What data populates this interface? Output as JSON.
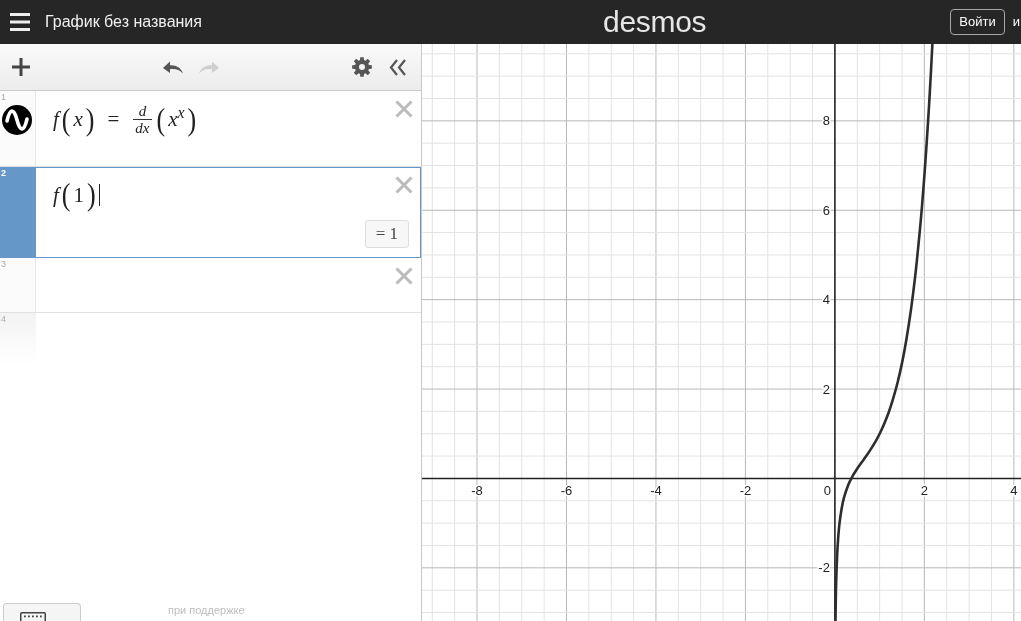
{
  "header": {
    "title": "График без названия",
    "logo": "desmos",
    "login_button": "Войти",
    "trailing_text": "и"
  },
  "toolbar": {
    "undo": {
      "disabled": false
    },
    "redo": {
      "disabled": true
    }
  },
  "expressions": [
    {
      "number": "1",
      "kind": "graph",
      "selected": false,
      "math": [
        {
          "kind": "var",
          "text": "f"
        },
        {
          "kind": "paren",
          "open": "(",
          "close": ")",
          "body": [
            {
              "kind": "var",
              "text": "x"
            }
          ]
        },
        {
          "kind": "op",
          "text": "="
        },
        {
          "kind": "frac",
          "num": "d",
          "den": "dx"
        },
        {
          "kind": "paren",
          "open": "(",
          "close": ")",
          "body": [
            {
              "kind": "var",
              "text": "x$^{x}$"
            }
          ]
        }
      ]
    },
    {
      "number": "2",
      "kind": "value",
      "selected": true,
      "math": [
        {
          "kind": "var",
          "text": "f"
        },
        {
          "kind": "paren",
          "open": "(",
          "close": ")",
          "body": [
            {
              "kind": "num",
              "text": "1"
            }
          ]
        }
      ],
      "result": "= 1"
    },
    {
      "number": "3",
      "kind": "empty",
      "selected": false
    },
    {
      "number": "4",
      "kind": "ghost",
      "selected": false
    }
  ],
  "footer": {
    "powered_by": "при поддержке"
  },
  "graph": {
    "origin_label": "0",
    "chart_data": {
      "type": "line",
      "grid": true,
      "xlim": [
        -9.23,
        4.16
      ],
      "ylim": [
        -3.19,
        9.72
      ],
      "xticks": [
        -8,
        -6,
        -4,
        -2,
        2,
        4
      ],
      "yticks": [
        -2,
        2,
        4,
        6,
        8
      ],
      "x": [
        0.0126,
        0.02,
        0.03,
        0.05,
        0.07,
        0.1,
        0.15,
        0.2,
        0.3,
        0.4,
        0.5,
        0.6,
        0.7,
        0.8,
        0.9,
        1,
        1.1,
        1.2,
        1.3,
        1.4,
        1.5,
        1.6,
        1.7,
        1.8,
        1.9,
        1.95,
        2,
        2.05,
        2.1,
        2.15,
        2.179
      ],
      "series": [
        {
          "color": "#2d2d2d",
          "values": [
            -3.19,
            -2.69,
            -2.26,
            -1.72,
            -1.38,
            -1.03,
            -0.68,
            -0.44,
            -0.14,
            0.06,
            0.22,
            0.36,
            0.5,
            0.65,
            0.81,
            1,
            1.22,
            1.47,
            1.78,
            2.14,
            2.58,
            3.12,
            3.77,
            4.57,
            5.56,
            6.13,
            6.77,
            7.48,
            8.27,
            9.15,
            9.72
          ]
        }
      ]
    }
  }
}
